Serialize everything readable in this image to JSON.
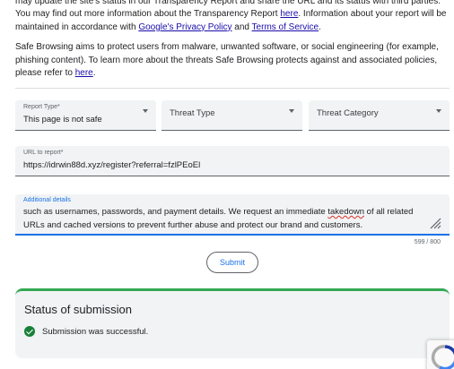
{
  "intro": {
    "p1_a": "may update the site's status in our Transparency Report and share the URL and its status with third parties. You may find out more information about the Transparency Report ",
    "p1_link1": "here",
    "p1_b": ". Information about your report will be maintained in accordance with ",
    "p1_link2": "Google's Privacy Policy",
    "p1_c": " and ",
    "p1_link3": "Terms of Service",
    "p1_d": ".",
    "p2_a": "Safe Browsing aims to protect users from malware, unwanted software, or social engineering (for example, phishing content). To learn more about the threats Safe Browsing protects against and associated policies, please refer to ",
    "p2_link": "here",
    "p2_b": "."
  },
  "form": {
    "report_type": {
      "label": "Report Type*",
      "value": "This page is not safe"
    },
    "threat_type": {
      "placeholder": "Threat Type"
    },
    "threat_category": {
      "placeholder": "Threat Category"
    },
    "url": {
      "label": "URL to report*",
      "value": "https://idrwin88d.xyz/register?referral=fzlPEoEl"
    },
    "details": {
      "label": "Additional details",
      "line1_a": "such as usernames, passwords, and payment details. We request an immediate ",
      "line1_flag": "takedown",
      "line1_b": " of all related",
      "line2": "URLs and cached versions to prevent further abuse and protect our brand and customers."
    },
    "counter": "599 / 800",
    "submit_label": "Submit"
  },
  "status": {
    "title": "Status of submission",
    "message": "Submission was successful."
  },
  "colors": {
    "accent": "#1a73e8",
    "success": "#34a853",
    "field_bg": "#f1f3f4"
  },
  "icons": {
    "dropdown": "chevron-down-icon",
    "success": "check-circle-icon",
    "resize": "resize-handle-icon",
    "recaptcha": "recaptcha-icon"
  }
}
